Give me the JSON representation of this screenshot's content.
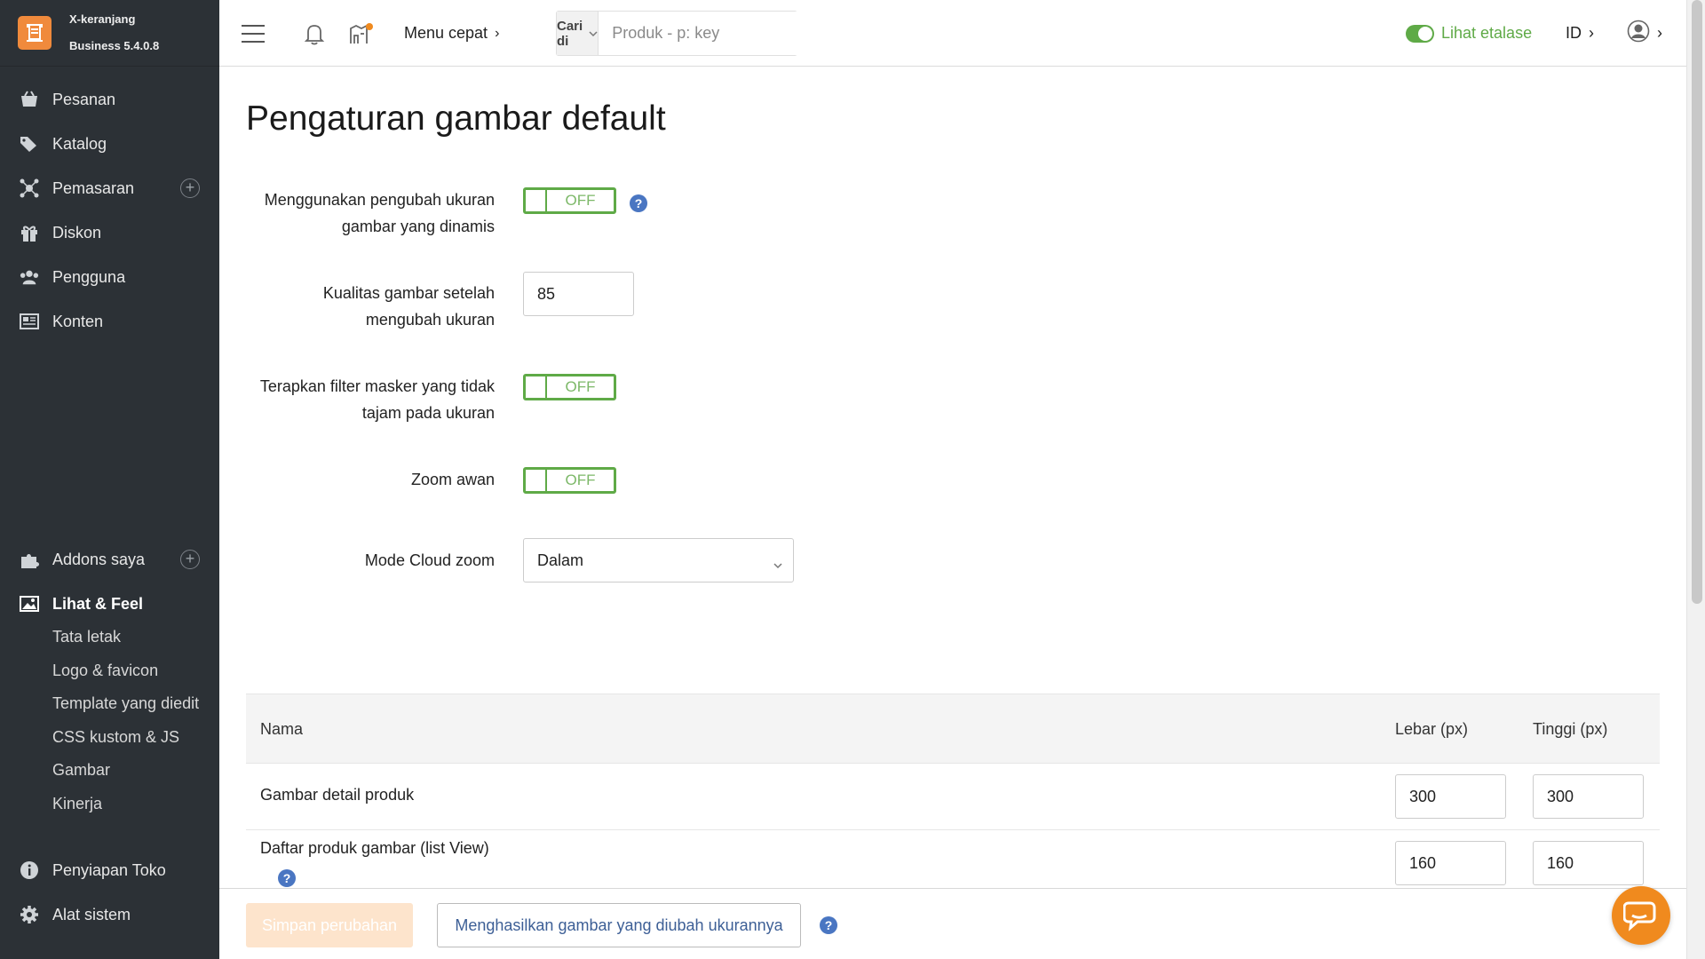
{
  "app": {
    "name": "X-keranjang",
    "version": "Business 5.4.0.8",
    "brand_color": "#f08a3c",
    "accent_color": "#5faa47"
  },
  "sidebar": {
    "items": [
      {
        "label": "Pesanan",
        "icon": "orders-icon"
      },
      {
        "label": "Katalog",
        "icon": "tags-icon"
      },
      {
        "label": "Pemasaran",
        "icon": "marketing-icon"
      },
      {
        "label": "Diskon",
        "icon": "gift-icon"
      },
      {
        "label": "Pengguna",
        "icon": "users-icon"
      },
      {
        "label": "Konten",
        "icon": "content-icon"
      }
    ],
    "lower_items": [
      {
        "label": "Addons saya",
        "icon": "puzzle-icon"
      },
      {
        "label": "Lihat & Feel",
        "icon": "image-icon"
      }
    ],
    "sub_items": [
      "Tata letak",
      "Logo & favicon",
      "Template yang diedit",
      "CSS kustom & JS",
      "Gambar",
      "Kinerja"
    ],
    "bottom_items": [
      {
        "label": "Penyiapan Toko",
        "icon": "info-icon"
      },
      {
        "label": "Alat sistem",
        "icon": "gear-icon"
      }
    ]
  },
  "topbar": {
    "quick_menu": "Menu cepat",
    "search_scope": "Cari di",
    "search_placeholder": "Produk - p: key",
    "storefront": "Lihat etalase",
    "language": "ID"
  },
  "page": {
    "title": "Pengaturan gambar default",
    "fields": {
      "dynamic_resizer": {
        "label_line1": "Menggunakan pengubah ukuran",
        "label_line2": "gambar yang dinamis",
        "state": "OFF"
      },
      "quality": {
        "label_line1": "Kualitas gambar setelah",
        "label_line2": "mengubah ukuran",
        "value": "85"
      },
      "unsharp": {
        "label_line1": "Terapkan filter masker yang tidak",
        "label_line2": "tajam pada ukuran",
        "state": "OFF"
      },
      "cloud_zoom": {
        "label": "Zoom awan",
        "state": "OFF"
      },
      "cloud_zoom_mode": {
        "label": "Mode Cloud zoom",
        "value": "Dalam"
      }
    },
    "table": {
      "headers": {
        "name": "Nama",
        "width": "Lebar (px)",
        "height": "Tinggi (px)"
      },
      "rows": [
        {
          "name": "Gambar detail produk",
          "width": "300",
          "height": "300"
        },
        {
          "name": "Daftar produk gambar (list View)",
          "width": "160",
          "height": "160"
        }
      ]
    }
  },
  "actions": {
    "save": "Simpan perubahan",
    "generate": "Menghasilkan gambar yang diubah ukurannya"
  }
}
